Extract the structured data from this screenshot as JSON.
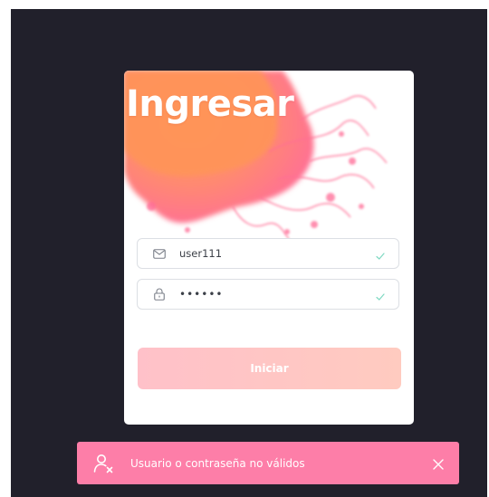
{
  "login": {
    "title": "Ingresar",
    "username_value": "user111",
    "password_value": "••••••",
    "submit_label": "Iniciar"
  },
  "toast": {
    "message": "Usuario o contraseña no válidos"
  },
  "colors": {
    "background": "#21202b",
    "card": "#ffffff",
    "toast": "#fd7ea8",
    "button": "#ffc4c6",
    "valid_check": "#7fd9c2"
  },
  "icons": {
    "username": "mail-icon",
    "password": "lock-icon",
    "valid": "check-icon",
    "toast": "user-x-icon",
    "close": "close-icon"
  }
}
